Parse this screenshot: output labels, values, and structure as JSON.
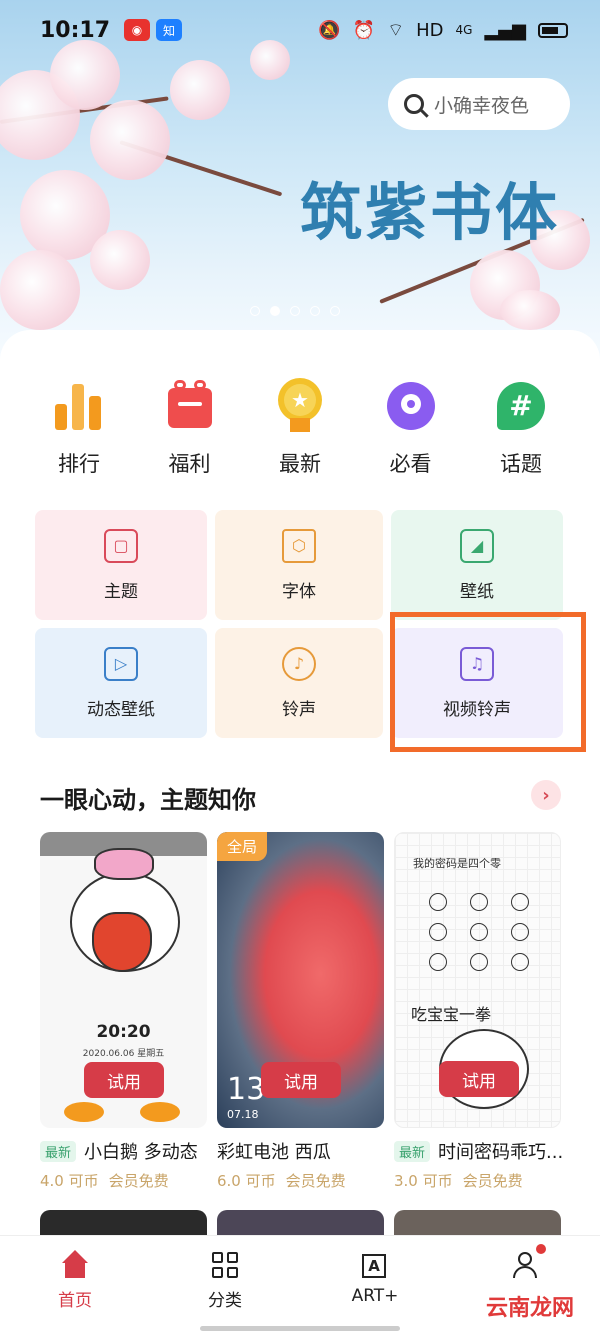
{
  "status_bar": {
    "time": "10:17",
    "network": "HD",
    "signal": "4G"
  },
  "search": {
    "placeholder": "小确幸夜色"
  },
  "banner": {
    "title": "筑紫书体"
  },
  "quick_nav": [
    {
      "label": "排行",
      "icon": "ranking-icon",
      "color": "#f39a1e"
    },
    {
      "label": "福利",
      "icon": "gift-icon",
      "color": "#ef4d4d"
    },
    {
      "label": "最新",
      "icon": "medal-icon",
      "color": "#f3b21e"
    },
    {
      "label": "必看",
      "icon": "eye-monster-icon",
      "color": "#8a5cf0"
    },
    {
      "label": "话题",
      "icon": "hashtag-icon",
      "color": "#2fb46a"
    }
  ],
  "categories": [
    {
      "label": "主题",
      "icon": "theme-icon",
      "bg": "#fdebee",
      "color": "#d94a5a"
    },
    {
      "label": "字体",
      "icon": "font-cube-icon",
      "bg": "#fdf2e6",
      "color": "#e69a3a"
    },
    {
      "label": "壁纸",
      "icon": "wallpaper-icon",
      "bg": "#e8f7ef",
      "color": "#3aa870"
    },
    {
      "label": "动态壁纸",
      "icon": "live-wallpaper-icon",
      "bg": "#e7f1fb",
      "color": "#3a7fc8"
    },
    {
      "label": "铃声",
      "icon": "ringtone-icon",
      "bg": "#fdf2e6",
      "color": "#e69a3a"
    },
    {
      "label": "视频铃声",
      "icon": "video-ringtone-icon",
      "bg": "#f1eefd",
      "color": "#7a5bd6"
    }
  ],
  "section": {
    "title": "一眼心动，主题知你",
    "more": "›"
  },
  "themes": [
    {
      "badge": "最新",
      "title": "小白鹅 多动态",
      "price": "4.0 可币",
      "member": "会员免费",
      "button": "试用",
      "clock": "20:20",
      "date": "2020.06.06 星期五",
      "colors": [
        "#f6f6f6",
        "#e9e9e9"
      ]
    },
    {
      "badge_all": "全局",
      "title": "彩虹电池 西瓜",
      "price": "6.0 可币",
      "member": "会员免费",
      "button": "试用",
      "clock": "13",
      "date": "07.18",
      "colors": [
        "#e5545a",
        "#2b3f5a"
      ]
    },
    {
      "badge": "最新",
      "title": "时间密码乖巧...",
      "price": "3.0 可币",
      "member": "会员免费",
      "button": "试用",
      "caption": "我的密码是四个零",
      "slogan": "吃宝宝一拳",
      "colors": [
        "#fbfbfb",
        "#eeeeee"
      ]
    }
  ],
  "bottom_nav": [
    {
      "label": "首页",
      "icon": "home-icon",
      "active": true
    },
    {
      "label": "分类",
      "icon": "grid-icon",
      "active": false
    },
    {
      "label": "ART+",
      "icon": "art-icon",
      "active": false
    },
    {
      "label": "",
      "icon": "profile-icon",
      "active": false
    }
  ],
  "watermark": "云南龙网"
}
